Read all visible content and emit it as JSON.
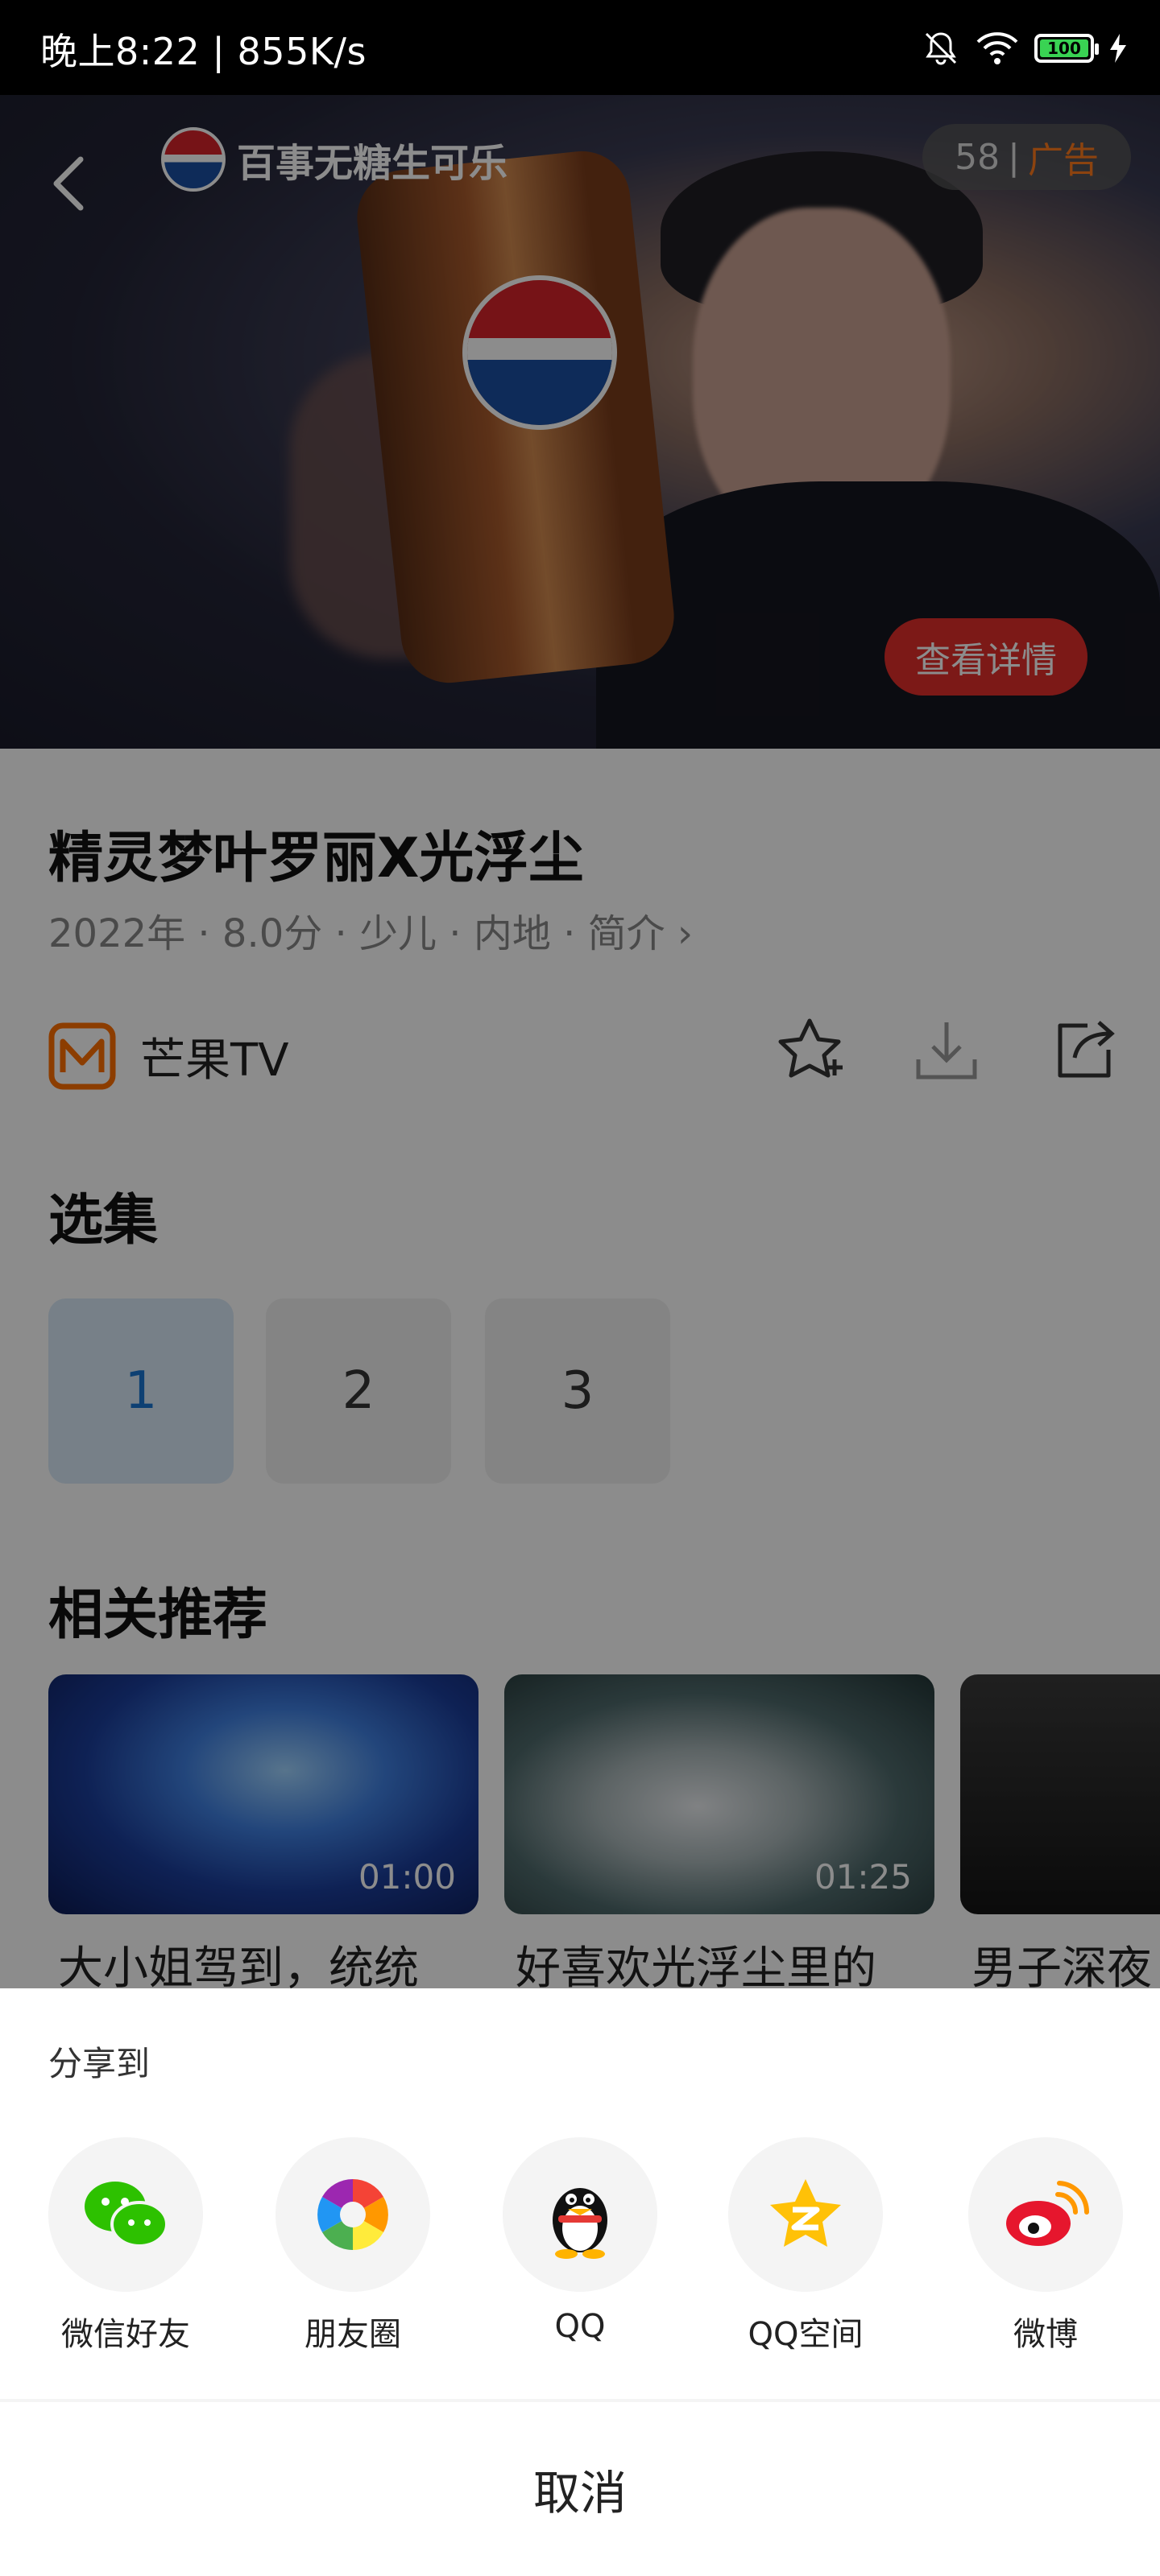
{
  "status_bar": {
    "time_speed": "晚上8:22 | 855K/s",
    "battery": "100"
  },
  "ad": {
    "brand_text": "百事无糖生可乐",
    "countdown": "58",
    "separator": "|",
    "ad_label": "广告",
    "detail_button": "查看详情"
  },
  "show": {
    "title": "精灵梦叶罗丽X光浮尘",
    "meta": "2022年 · 8.0分 · 少儿 · 内地 · 简介 ›",
    "source_name": "芒果TV"
  },
  "episodes": {
    "heading": "选集",
    "items": [
      "1",
      "2",
      "3"
    ]
  },
  "recommend": {
    "heading": "相关推荐",
    "items": [
      {
        "duration": "01:00",
        "title": "大小姐驾到，统统"
      },
      {
        "duration": "01:25",
        "title": "好喜欢光浮尘里的"
      },
      {
        "duration": "",
        "title": "男子深夜"
      }
    ]
  },
  "share_sheet": {
    "label": "分享到",
    "targets": [
      {
        "label": "微信好友",
        "icon": "wechat-icon"
      },
      {
        "label": "朋友圈",
        "icon": "moments-icon"
      },
      {
        "label": "QQ",
        "icon": "qq-icon"
      },
      {
        "label": "QQ空间",
        "icon": "qzone-icon"
      },
      {
        "label": "微博",
        "icon": "weibo-icon"
      }
    ],
    "cancel": "取消"
  },
  "colors": {
    "accent_blue": "#1976d2",
    "ad_orange": "#ff7b1c",
    "detail_red": "#e22e2a",
    "wechat_green": "#2dc100",
    "mango_orange": "#ff6f00"
  }
}
